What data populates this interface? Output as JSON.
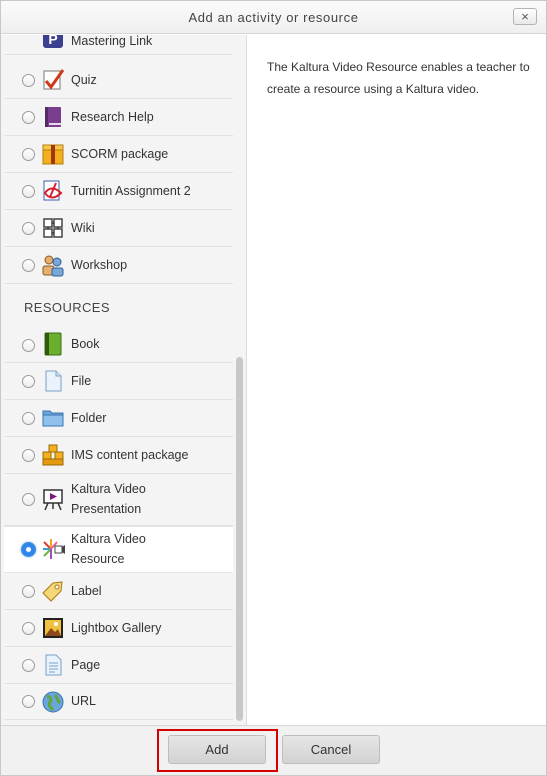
{
  "dialog": {
    "title": "Add an activity or resource",
    "close_label": "×"
  },
  "activities": [
    {
      "label": "Mastering Link",
      "icon": "mastering-link-icon"
    },
    {
      "label": "Quiz",
      "icon": "quiz-icon"
    },
    {
      "label": "Research Help",
      "icon": "book-purple-icon"
    },
    {
      "label": "SCORM package",
      "icon": "package-box-icon"
    },
    {
      "label": "Turnitin Assignment 2",
      "icon": "turnitin-icon"
    },
    {
      "label": "Wiki",
      "icon": "wiki-icon"
    },
    {
      "label": "Workshop",
      "icon": "workshop-icon"
    }
  ],
  "resources_header": "RESOURCES",
  "resources": [
    {
      "label": "Book",
      "icon": "book-icon"
    },
    {
      "label": "File",
      "icon": "file-icon"
    },
    {
      "label": "Folder",
      "icon": "folder-icon"
    },
    {
      "label": "IMS content package",
      "icon": "ims-package-icon"
    },
    {
      "label_line1": "Kaltura Video",
      "label_line2": "Presentation",
      "icon": "kaltura-presentation-icon"
    },
    {
      "label_line1": "Kaltura Video",
      "label_line2": "Resource",
      "icon": "kaltura-resource-icon",
      "selected": true
    },
    {
      "label": "Label",
      "icon": "label-tag-icon"
    },
    {
      "label": "Lightbox Gallery",
      "icon": "lightbox-gallery-icon"
    },
    {
      "label": "Page",
      "icon": "page-icon"
    },
    {
      "label": "URL",
      "icon": "url-globe-icon"
    }
  ],
  "summary": "The Kaltura Video Resource enables a teacher to create a resource using a Kaltura video.",
  "footer": {
    "add_label": "Add",
    "cancel_label": "Cancel"
  },
  "colors": {
    "selected_radio": "#2f86ea",
    "highlight_border": "#d60000"
  }
}
